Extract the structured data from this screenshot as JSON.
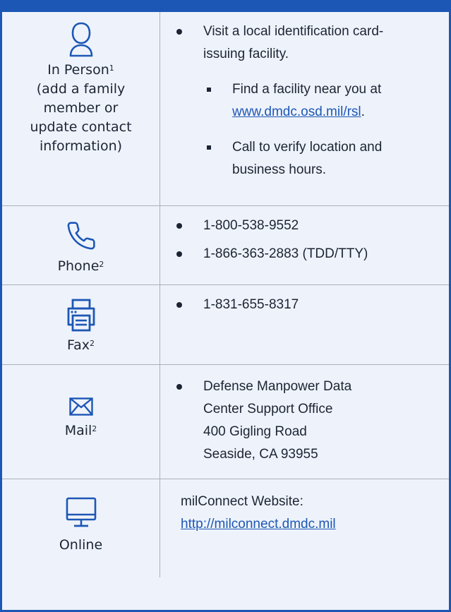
{
  "in_person": {
    "label_lines": [
      "In Person",
      "(add a family",
      "member or",
      "update contact",
      "information)"
    ],
    "footnote": "1",
    "bullet": "Visit a local identification card-issuing facility.",
    "sub1_text": "Find a facility near you at",
    "sub1_link": "www.dmdc.osd.mil/rsl",
    "sub1_after": ".",
    "sub2_text": "Call to verify location and business hours."
  },
  "phone": {
    "label": "Phone",
    "footnote": "2",
    "items": [
      "1-800-538-9552",
      "1-866-363-2883 (TDD/TTY)"
    ]
  },
  "fax": {
    "label": "Fax",
    "footnote": "2",
    "items": [
      "1-831-655-8317"
    ]
  },
  "mail": {
    "label": "Mail",
    "footnote": "2",
    "lines": [
      "Defense Manpower Data",
      "Center Support Office",
      "400 Gigling Road",
      "Seaside, CA 93955"
    ]
  },
  "online": {
    "label": "Online",
    "text": "milConnect Website:",
    "link": "http://milconnect.dmdc.mil"
  },
  "colors": {
    "accent": "#1d57b5",
    "text": "#1d2433",
    "background": "#eef3fb",
    "rule": "#aab0ba"
  }
}
